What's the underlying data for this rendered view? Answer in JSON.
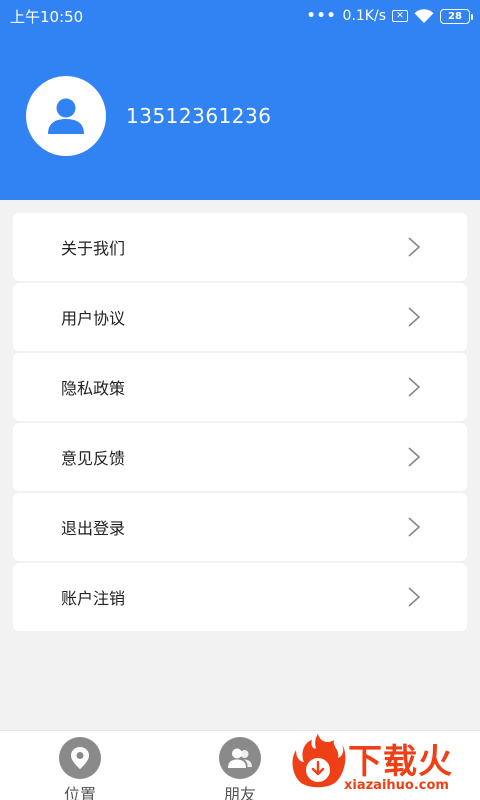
{
  "status_bar": {
    "time": "上午10:50",
    "speed": "0.1K/s",
    "dots": "•••",
    "sim_label": "✕",
    "battery": "28"
  },
  "profile": {
    "phone": "13512361236"
  },
  "menu": {
    "items": [
      {
        "label": "关于我们"
      },
      {
        "label": "用户协议"
      },
      {
        "label": "隐私政策"
      },
      {
        "label": "意见反馈"
      },
      {
        "label": "退出登录"
      },
      {
        "label": "账户注销"
      }
    ]
  },
  "bottom_nav": {
    "items": [
      {
        "label": "位置",
        "icon": "location-pin-icon"
      },
      {
        "label": "朋友",
        "icon": "friends-icon"
      }
    ]
  },
  "watermark": {
    "title": "下载火",
    "url": "xiazaihuo.com"
  },
  "colors": {
    "primary": "#3183f3",
    "background": "#f2f2f2",
    "watermark": "#ef3f16"
  }
}
